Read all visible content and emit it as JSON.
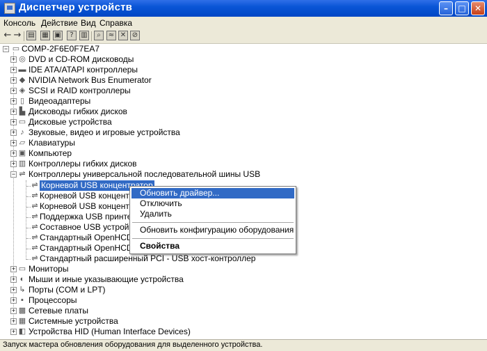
{
  "window": {
    "title": "Диспетчер устройств"
  },
  "menu": [
    "Консоль",
    "Действие",
    "Вид",
    "Справка"
  ],
  "tree": {
    "root": "COMP-2F6E0F7EA7",
    "categories": [
      {
        "label": "DVD и CD-ROM дисководы",
        "icon": "cdrom-icon"
      },
      {
        "label": "IDE ATA/ATAPI контроллеры",
        "icon": "ide-controller-icon"
      },
      {
        "label": "NVIDIA Network Bus Enumerator",
        "icon": "network-bus-icon"
      },
      {
        "label": "SCSI и RAID контроллеры",
        "icon": "scsi-controller-icon"
      },
      {
        "label": "Видеоадаптеры",
        "icon": "display-adapter-icon"
      },
      {
        "label": "Дисководы гибких дисков",
        "icon": "floppy-drive-icon"
      },
      {
        "label": "Дисковые устройства",
        "icon": "disk-drive-icon"
      },
      {
        "label": "Звуковые, видео и игровые устройства",
        "icon": "sound-device-icon"
      },
      {
        "label": "Клавиатуры",
        "icon": "keyboard-icon"
      },
      {
        "label": "Компьютер",
        "icon": "computer-icon"
      },
      {
        "label": "Контроллеры гибких дисков",
        "icon": "floppy-controller-icon"
      },
      {
        "label": "Контроллеры универсальной последовательной шины USB",
        "icon": "usb-icon"
      }
    ],
    "usb_children": [
      "Корневой USB концентратор",
      "Корневой USB концентратор",
      "Корневой USB концентратор",
      "Поддержка USB принтера",
      "Составное USB устройство",
      "Стандартный OpenHCD USB хост-контроллер",
      "Стандартный OpenHCD USB хост-контроллер",
      "Стандартный расширенный PCI - USB хост-контроллер"
    ],
    "usb_children_visible": [
      "Корневой USB концентратор",
      "Корневой USB концентрат",
      "Корневой USB концентрат",
      "Поддержка USB принтер",
      "Составное USB устройств",
      "Стандартный OpenHCD U",
      "Стандартный OpenHCD U",
      "Стандартный расширенный PCI - USB хост-контроллер"
    ],
    "categories_after": [
      {
        "label": "Мониторы",
        "icon": "monitor-icon"
      },
      {
        "label": "Мыши и иные указывающие устройства",
        "icon": "mouse-icon"
      },
      {
        "label": "Порты (COM и LPT)",
        "icon": "port-icon"
      },
      {
        "label": "Процессоры",
        "icon": "processor-icon"
      },
      {
        "label": "Сетевые платы",
        "icon": "network-card-icon"
      },
      {
        "label": "Системные устройства",
        "icon": "system-device-icon"
      },
      {
        "label": "Устройства HID (Human Interface Devices)",
        "icon": "hid-device-icon"
      }
    ]
  },
  "context_menu": {
    "items": [
      "Обновить драйвер...",
      "Отключить",
      "Удалить",
      "Обновить конфигурацию оборудования",
      "Свойства"
    ]
  },
  "status_bar": {
    "text": "Запуск мастера обновления оборудования для выделенного устройства."
  }
}
